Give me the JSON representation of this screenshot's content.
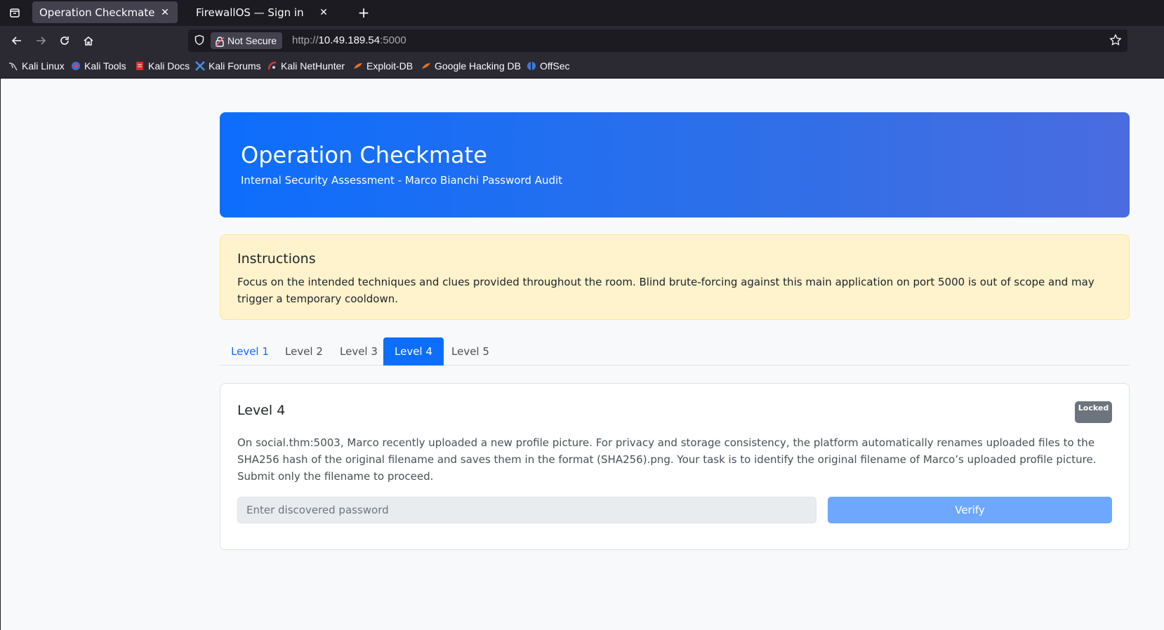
{
  "browser": {
    "tabs": [
      {
        "title": "Operation Checkmate",
        "active": true
      },
      {
        "title": "FirewallOS — Sign in",
        "active": false
      }
    ],
    "url_security_label": "Not Secure",
    "url_prefix": "http://",
    "url_host": "10.49.189.54",
    "url_port": ":5000",
    "bookmarks": [
      {
        "label": "Kali Linux",
        "icon": "kali-dragon-icon"
      },
      {
        "label": "Kali Tools",
        "icon": "kali-tools-icon"
      },
      {
        "label": "Kali Docs",
        "icon": "kali-docs-icon"
      },
      {
        "label": "Kali Forums",
        "icon": "kali-forums-icon"
      },
      {
        "label": "Kali NetHunter",
        "icon": "nethunter-icon"
      },
      {
        "label": "Exploit-DB",
        "icon": "exploit-db-icon"
      },
      {
        "label": "Google Hacking DB",
        "icon": "ghdb-icon"
      },
      {
        "label": "OffSec",
        "icon": "offsec-icon"
      }
    ]
  },
  "hero": {
    "title": "Operation Checkmate",
    "subtitle": "Internal Security Assessment - Marco Bianchi Password Audit"
  },
  "instructions": {
    "heading": "Instructions",
    "text": "Focus on the intended techniques and clues provided throughout the room. Blind brute-forcing against this main application on port 5000 is out of scope and may trigger a temporary cooldown."
  },
  "levels": {
    "tabs": [
      "Level 1",
      "Level 2",
      "Level 3",
      "Level 4",
      "Level 5"
    ],
    "active": "Level 4"
  },
  "card": {
    "title": "Level 4",
    "badge": "Locked",
    "description": "On social.thm:5003, Marco recently uploaded a new profile picture. For privacy and storage consistency, the platform automatically renames uploaded files to the SHA256 hash of the original filename and saves them in the format (SHA256).png. Your task is to identify the original filename of Marco’s uploaded profile picture. Submit only the filename to proceed.",
    "input_placeholder": "Enter discovered password",
    "button_label": "Verify"
  },
  "colors": {
    "primary": "#0d6efd",
    "alert_bg": "#fff3cd",
    "badge_bg": "#6c757d",
    "button_disabled": "#6ea8fe"
  }
}
